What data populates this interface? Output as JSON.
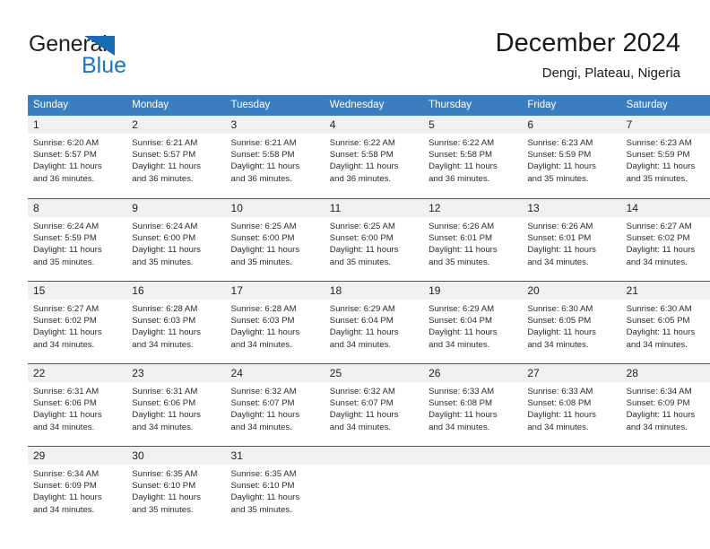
{
  "logo": {
    "text_primary": "General",
    "text_secondary": "Blue",
    "primary_color": "#231f20",
    "secondary_color": "#1a75c4",
    "triangle_color": "#1a6bb5",
    "icon": "triangle-logo-icon"
  },
  "header": {
    "title": "December 2024",
    "subtitle": "Dengi, Plateau, Nigeria"
  },
  "theme": {
    "header_bar_color": "#3b7ec0",
    "row_divider_color": "#2a6099",
    "daynum_bg_color": "#f0f0f0",
    "page_bg_color": "#ffffff"
  },
  "calendar": {
    "columns": [
      "Sunday",
      "Monday",
      "Tuesday",
      "Wednesday",
      "Thursday",
      "Friday",
      "Saturday"
    ],
    "weeks": [
      [
        {
          "day": "1",
          "sunrise": "Sunrise: 6:20 AM",
          "sunset": "Sunset: 5:57 PM",
          "daylight1": "Daylight: 11 hours",
          "daylight2": "and 36 minutes."
        },
        {
          "day": "2",
          "sunrise": "Sunrise: 6:21 AM",
          "sunset": "Sunset: 5:57 PM",
          "daylight1": "Daylight: 11 hours",
          "daylight2": "and 36 minutes."
        },
        {
          "day": "3",
          "sunrise": "Sunrise: 6:21 AM",
          "sunset": "Sunset: 5:58 PM",
          "daylight1": "Daylight: 11 hours",
          "daylight2": "and 36 minutes."
        },
        {
          "day": "4",
          "sunrise": "Sunrise: 6:22 AM",
          "sunset": "Sunset: 5:58 PM",
          "daylight1": "Daylight: 11 hours",
          "daylight2": "and 36 minutes."
        },
        {
          "day": "5",
          "sunrise": "Sunrise: 6:22 AM",
          "sunset": "Sunset: 5:58 PM",
          "daylight1": "Daylight: 11 hours",
          "daylight2": "and 36 minutes."
        },
        {
          "day": "6",
          "sunrise": "Sunrise: 6:23 AM",
          "sunset": "Sunset: 5:59 PM",
          "daylight1": "Daylight: 11 hours",
          "daylight2": "and 35 minutes."
        },
        {
          "day": "7",
          "sunrise": "Sunrise: 6:23 AM",
          "sunset": "Sunset: 5:59 PM",
          "daylight1": "Daylight: 11 hours",
          "daylight2": "and 35 minutes."
        }
      ],
      [
        {
          "day": "8",
          "sunrise": "Sunrise: 6:24 AM",
          "sunset": "Sunset: 5:59 PM",
          "daylight1": "Daylight: 11 hours",
          "daylight2": "and 35 minutes."
        },
        {
          "day": "9",
          "sunrise": "Sunrise: 6:24 AM",
          "sunset": "Sunset: 6:00 PM",
          "daylight1": "Daylight: 11 hours",
          "daylight2": "and 35 minutes."
        },
        {
          "day": "10",
          "sunrise": "Sunrise: 6:25 AM",
          "sunset": "Sunset: 6:00 PM",
          "daylight1": "Daylight: 11 hours",
          "daylight2": "and 35 minutes."
        },
        {
          "day": "11",
          "sunrise": "Sunrise: 6:25 AM",
          "sunset": "Sunset: 6:00 PM",
          "daylight1": "Daylight: 11 hours",
          "daylight2": "and 35 minutes."
        },
        {
          "day": "12",
          "sunrise": "Sunrise: 6:26 AM",
          "sunset": "Sunset: 6:01 PM",
          "daylight1": "Daylight: 11 hours",
          "daylight2": "and 35 minutes."
        },
        {
          "day": "13",
          "sunrise": "Sunrise: 6:26 AM",
          "sunset": "Sunset: 6:01 PM",
          "daylight1": "Daylight: 11 hours",
          "daylight2": "and 34 minutes."
        },
        {
          "day": "14",
          "sunrise": "Sunrise: 6:27 AM",
          "sunset": "Sunset: 6:02 PM",
          "daylight1": "Daylight: 11 hours",
          "daylight2": "and 34 minutes."
        }
      ],
      [
        {
          "day": "15",
          "sunrise": "Sunrise: 6:27 AM",
          "sunset": "Sunset: 6:02 PM",
          "daylight1": "Daylight: 11 hours",
          "daylight2": "and 34 minutes."
        },
        {
          "day": "16",
          "sunrise": "Sunrise: 6:28 AM",
          "sunset": "Sunset: 6:03 PM",
          "daylight1": "Daylight: 11 hours",
          "daylight2": "and 34 minutes."
        },
        {
          "day": "17",
          "sunrise": "Sunrise: 6:28 AM",
          "sunset": "Sunset: 6:03 PM",
          "daylight1": "Daylight: 11 hours",
          "daylight2": "and 34 minutes."
        },
        {
          "day": "18",
          "sunrise": "Sunrise: 6:29 AM",
          "sunset": "Sunset: 6:04 PM",
          "daylight1": "Daylight: 11 hours",
          "daylight2": "and 34 minutes."
        },
        {
          "day": "19",
          "sunrise": "Sunrise: 6:29 AM",
          "sunset": "Sunset: 6:04 PM",
          "daylight1": "Daylight: 11 hours",
          "daylight2": "and 34 minutes."
        },
        {
          "day": "20",
          "sunrise": "Sunrise: 6:30 AM",
          "sunset": "Sunset: 6:05 PM",
          "daylight1": "Daylight: 11 hours",
          "daylight2": "and 34 minutes."
        },
        {
          "day": "21",
          "sunrise": "Sunrise: 6:30 AM",
          "sunset": "Sunset: 6:05 PM",
          "daylight1": "Daylight: 11 hours",
          "daylight2": "and 34 minutes."
        }
      ],
      [
        {
          "day": "22",
          "sunrise": "Sunrise: 6:31 AM",
          "sunset": "Sunset: 6:06 PM",
          "daylight1": "Daylight: 11 hours",
          "daylight2": "and 34 minutes."
        },
        {
          "day": "23",
          "sunrise": "Sunrise: 6:31 AM",
          "sunset": "Sunset: 6:06 PM",
          "daylight1": "Daylight: 11 hours",
          "daylight2": "and 34 minutes."
        },
        {
          "day": "24",
          "sunrise": "Sunrise: 6:32 AM",
          "sunset": "Sunset: 6:07 PM",
          "daylight1": "Daylight: 11 hours",
          "daylight2": "and 34 minutes."
        },
        {
          "day": "25",
          "sunrise": "Sunrise: 6:32 AM",
          "sunset": "Sunset: 6:07 PM",
          "daylight1": "Daylight: 11 hours",
          "daylight2": "and 34 minutes."
        },
        {
          "day": "26",
          "sunrise": "Sunrise: 6:33 AM",
          "sunset": "Sunset: 6:08 PM",
          "daylight1": "Daylight: 11 hours",
          "daylight2": "and 34 minutes."
        },
        {
          "day": "27",
          "sunrise": "Sunrise: 6:33 AM",
          "sunset": "Sunset: 6:08 PM",
          "daylight1": "Daylight: 11 hours",
          "daylight2": "and 34 minutes."
        },
        {
          "day": "28",
          "sunrise": "Sunrise: 6:34 AM",
          "sunset": "Sunset: 6:09 PM",
          "daylight1": "Daylight: 11 hours",
          "daylight2": "and 34 minutes."
        }
      ],
      [
        {
          "day": "29",
          "sunrise": "Sunrise: 6:34 AM",
          "sunset": "Sunset: 6:09 PM",
          "daylight1": "Daylight: 11 hours",
          "daylight2": "and 34 minutes."
        },
        {
          "day": "30",
          "sunrise": "Sunrise: 6:35 AM",
          "sunset": "Sunset: 6:10 PM",
          "daylight1": "Daylight: 11 hours",
          "daylight2": "and 35 minutes."
        },
        {
          "day": "31",
          "sunrise": "Sunrise: 6:35 AM",
          "sunset": "Sunset: 6:10 PM",
          "daylight1": "Daylight: 11 hours",
          "daylight2": "and 35 minutes."
        },
        {
          "day": "",
          "sunrise": "",
          "sunset": "",
          "daylight1": "",
          "daylight2": ""
        },
        {
          "day": "",
          "sunrise": "",
          "sunset": "",
          "daylight1": "",
          "daylight2": ""
        },
        {
          "day": "",
          "sunrise": "",
          "sunset": "",
          "daylight1": "",
          "daylight2": ""
        },
        {
          "day": "",
          "sunrise": "",
          "sunset": "",
          "daylight1": "",
          "daylight2": ""
        }
      ]
    ]
  }
}
